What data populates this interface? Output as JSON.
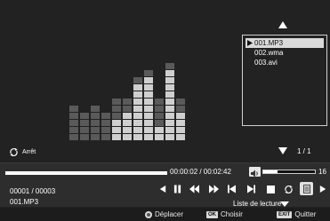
{
  "status": {
    "repeat_icon": "repeat-icon",
    "repeat_label": "Arrêt"
  },
  "playlist": {
    "items": [
      {
        "label": "001.MP3",
        "selected": true
      },
      {
        "label": "002.wma",
        "selected": false
      },
      {
        "label": "003.avi",
        "selected": false
      }
    ],
    "page": "1 / 1",
    "scroll_up_icon": "triangle-up-icon",
    "scroll_down_icon": "triangle-down-icon"
  },
  "playback": {
    "time": "00:00:02 / 00:02:42",
    "progress": 0.01,
    "volume_value": "16",
    "volume_level": 0.27,
    "track_counter": "00001 / 00003",
    "filename": "001.MP3",
    "playlist_label": "Liste de lecture"
  },
  "footer": {
    "move_label": "Déplacer",
    "ok_key": "OK",
    "ok_label": "Choisir",
    "exit_key": "EXIT",
    "exit_label": "Quitter"
  },
  "equalizer": {
    "columns": [
      {
        "light": 0,
        "dark": 5
      },
      {
        "light": 0,
        "dark": 4
      },
      {
        "light": 0,
        "dark": 5
      },
      {
        "light": 0,
        "dark": 4
      },
      {
        "light": 3,
        "dark": 3
      },
      {
        "light": 4,
        "dark": 2
      },
      {
        "light": 8,
        "dark": 1
      },
      {
        "light": 9,
        "dark": 1
      },
      {
        "light": 2,
        "dark": 4
      },
      {
        "light": 10,
        "dark": 1
      },
      {
        "light": 4,
        "dark": 2
      }
    ]
  },
  "colors": {
    "background": "#222222",
    "eq_light": "#cfcfcf",
    "eq_dark": "#5a5a5a",
    "selection": "#d9d9d9"
  }
}
